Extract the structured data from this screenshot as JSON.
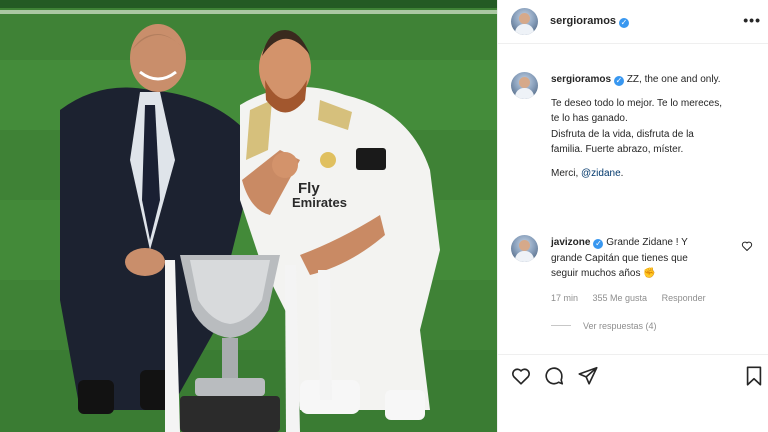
{
  "post": {
    "author": "sergioramos",
    "verified_mark": "✓"
  },
  "caption": {
    "username": "sergioramos",
    "line1": "ZZ, the one and only.",
    "para2_a": "Te deseo todo lo mejor. Te lo mereces,",
    "para2_b": "te lo has ganado.",
    "para2_c": "Disfruta de la vida, disfruta de la",
    "para2_d": "familia. Fuerte abrazo, míster.",
    "merci": "Merci,",
    "mention": "@zidane",
    "end": "."
  },
  "comment": {
    "username": "javizone",
    "text_a": "Grande Zidane ! Y",
    "text_b": "grande Capitán que tienes que",
    "text_c": "seguir muchos años",
    "emoji": "✊",
    "time": "17 min",
    "likes": "355 Me gusta",
    "reply": "Responder",
    "view_replies": "Ver respuestas (4)"
  },
  "icons": {
    "more": "more-options-icon",
    "like": "heart-icon",
    "comment": "comment-icon",
    "share": "paper-plane-icon",
    "save": "bookmark-icon"
  },
  "colors": {
    "verified": "#3897f0",
    "mention": "#00376b",
    "muted": "#8e8e8e",
    "pitch": "#48913b"
  }
}
